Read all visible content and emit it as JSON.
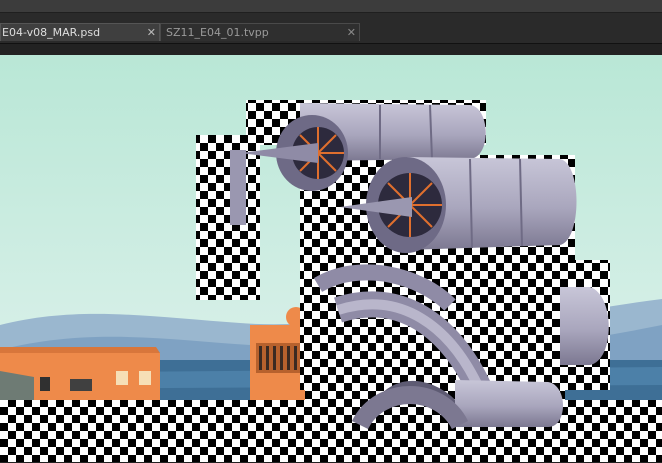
{
  "tabs": [
    {
      "label": "E04-v08_MAR.psd",
      "close_symbol": "✕",
      "active": true
    },
    {
      "label": "SZ11_E04_01.tvpp",
      "close_symbol": "✕",
      "active": false
    }
  ],
  "colors": {
    "sky_top": "#b9e7d6",
    "sky_bottom": "#e3f3ef",
    "hills": "#7fa2c3",
    "sea": "#3e6f96",
    "building_orange": "#ee8a4a",
    "engine_metal": "#a9a6bd",
    "engine_dark": "#5e5b73",
    "fan_orange": "#e06f2e",
    "teal_pool": "#4fc7bd"
  },
  "canvas": {
    "content": "artwork with jet engine illustration and transparency checkerboard",
    "icons": [
      "checkerboard-transparency-icon",
      "jet-engine-illustration"
    ]
  }
}
